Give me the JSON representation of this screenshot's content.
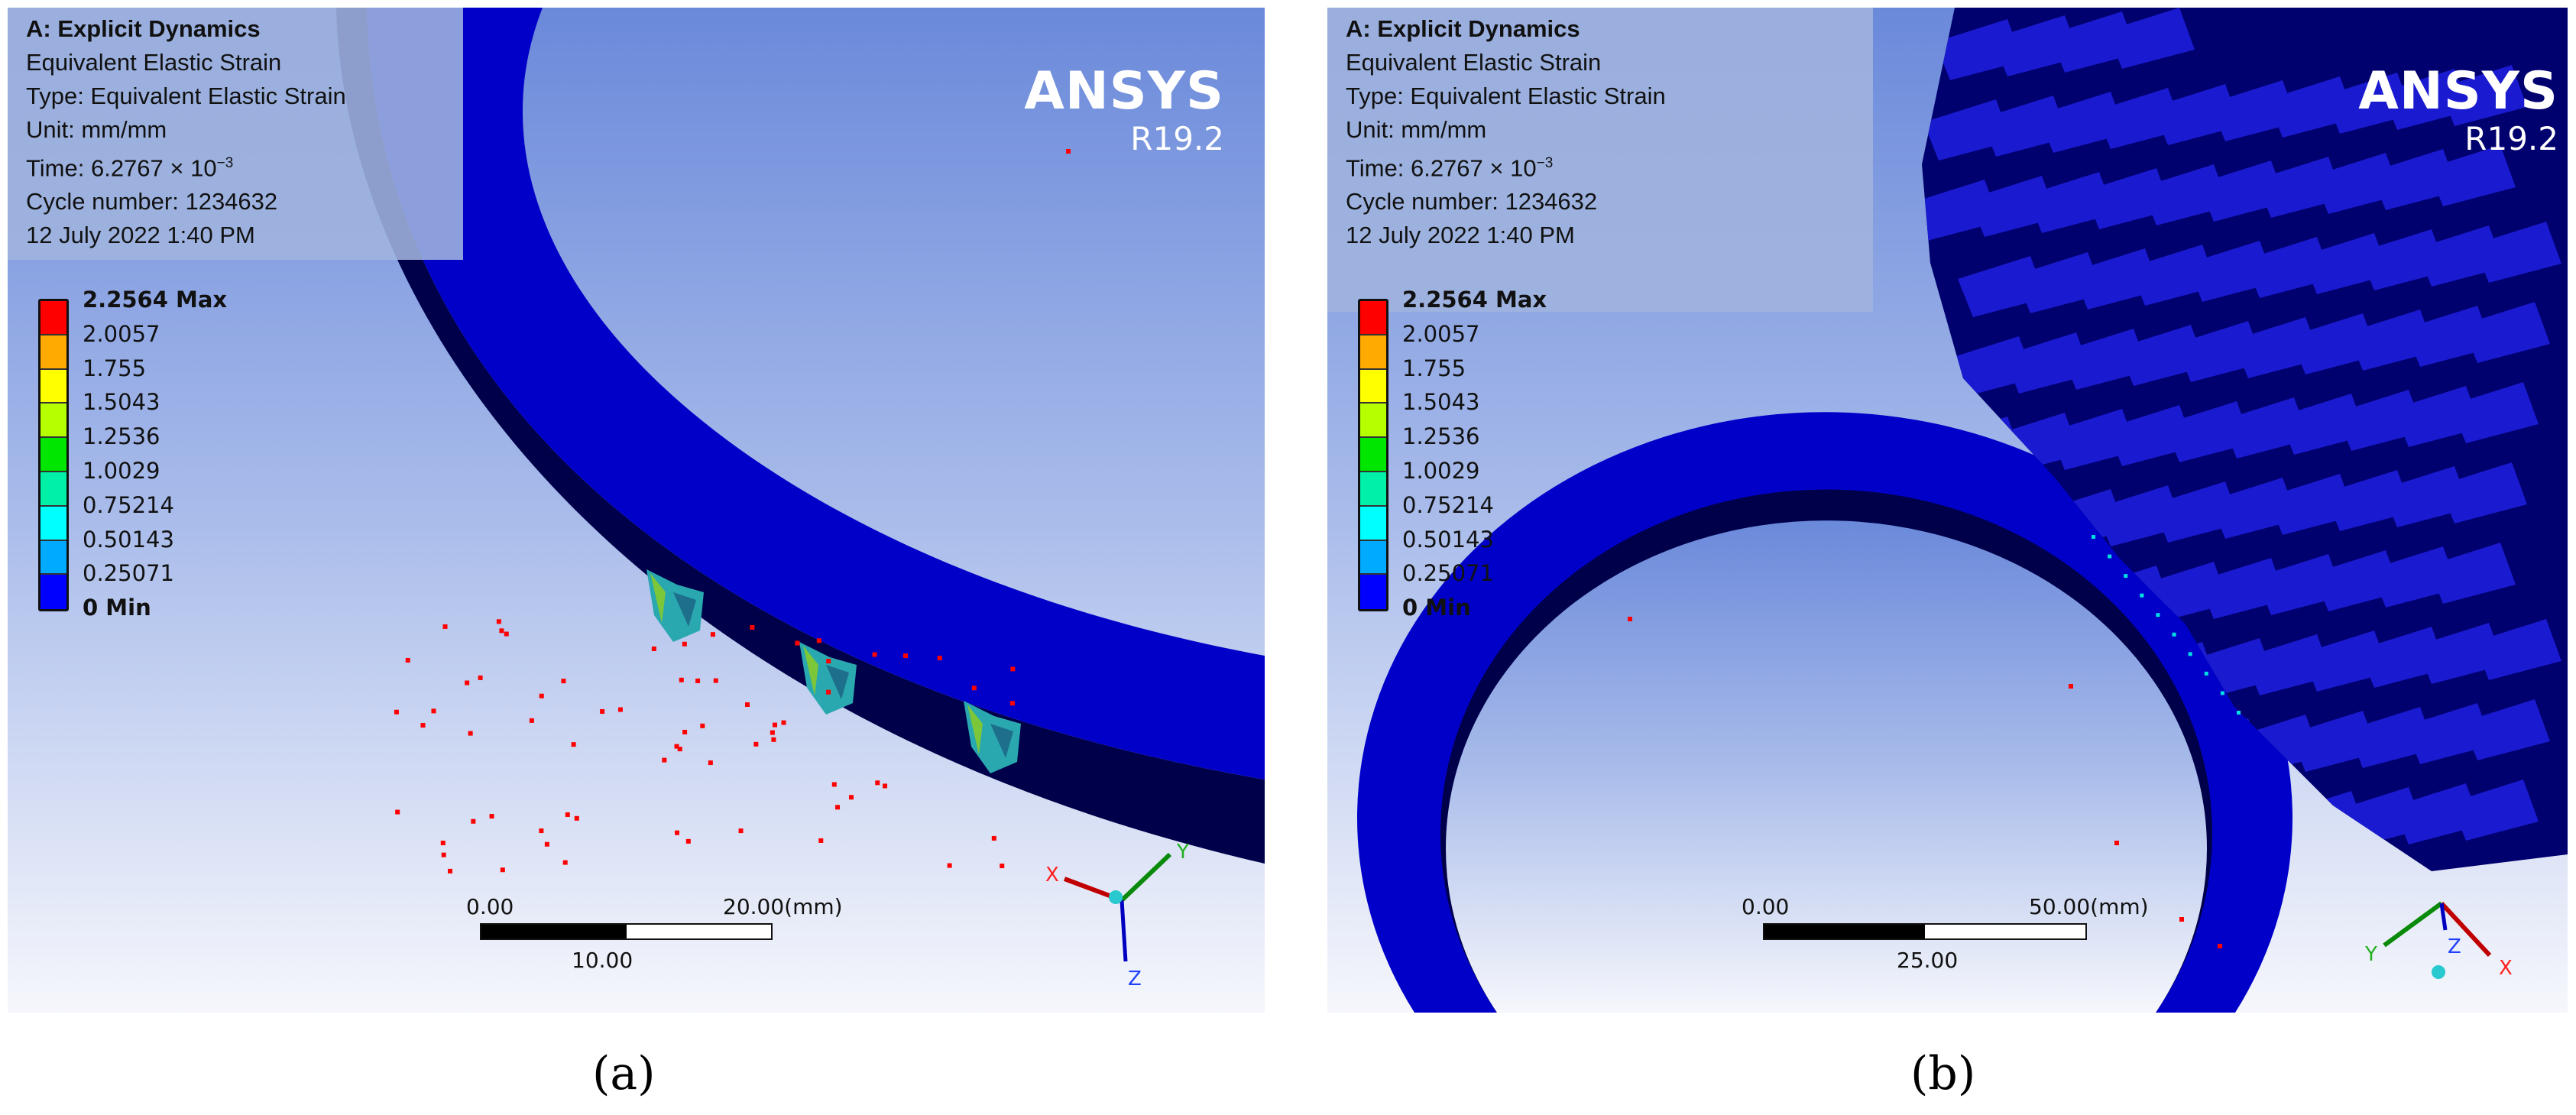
{
  "panels": [
    {
      "caption": "(a)",
      "info": {
        "title": "A: Explicit Dynamics",
        "result": "Equivalent Elastic Strain",
        "type": "Type:   Equivalent Elastic Strain",
        "unit": "Unit: mm/mm",
        "time": "Time: 6.2767 × 10",
        "time_exp": "−3",
        "cycle": "Cycle number: 1234632",
        "date": "12 July 2022 1:40 PM"
      },
      "logo": {
        "name": "ANSYS",
        "version": "R19.2"
      },
      "legend": {
        "labels": [
          "2.2564 Max",
          "2.0057",
          "1.755",
          "1.5043",
          "1.2536",
          "1.0029",
          "0.75214",
          "0.50143",
          "0.25071",
          "0 Min"
        ],
        "colors": [
          "#ff0000",
          "#ffaa00",
          "#ffff00",
          "#b5ff00",
          "#00e600",
          "#00f0a8",
          "#00ffff",
          "#00aaff",
          "#0000ff"
        ]
      },
      "scale_bar": {
        "start": "0.00",
        "end": "20.00(mm)",
        "mid": "10.00"
      },
      "triad": {
        "x": "X",
        "y": "Y",
        "z": "Z"
      }
    },
    {
      "caption": "(b)",
      "info": {
        "title": "A: Explicit Dynamics",
        "result": "Equivalent Elastic Strain",
        "type": "Type:   Equivalent Elastic Strain",
        "unit": "Unit: mm/mm",
        "time": "Time: 6.2767 × 10",
        "time_exp": "−3",
        "cycle": "Cycle number: 1234632",
        "date": "12 July 2022 1:40 PM"
      },
      "logo": {
        "name": "ANSYS",
        "version": "R19.2"
      },
      "legend": {
        "labels": [
          "2.2564 Max",
          "2.0057",
          "1.755",
          "1.5043",
          "1.2536",
          "1.0029",
          "0.75214",
          "0.50143",
          "0.25071",
          "0 Min"
        ],
        "colors": [
          "#ff0000",
          "#ffaa00",
          "#ffff00",
          "#b5ff00",
          "#00e600",
          "#00f0a8",
          "#00ffff",
          "#00aaff",
          "#0000ff"
        ]
      },
      "scale_bar": {
        "start": "0.00",
        "end": "50.00(mm)",
        "mid": "25.00"
      },
      "triad": {
        "x": "X",
        "y": "Y",
        "z": "Z"
      }
    }
  ],
  "colors": {
    "ring_face": "#0000c8",
    "ring_side": "#00004a",
    "gear_body": "#00006e",
    "gear_tooth": "#1a1ad0",
    "particle": "#ff0000"
  }
}
